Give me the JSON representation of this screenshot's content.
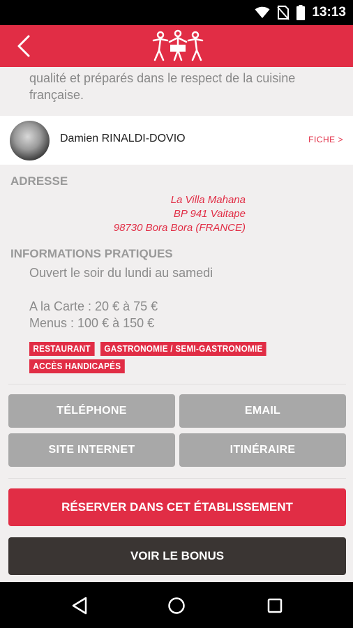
{
  "status_bar": {
    "time": "13:13",
    "icons": [
      "wifi-icon",
      "no-sim-icon",
      "battery-icon"
    ]
  },
  "app_bar": {
    "back_icon": "chevron-left-icon",
    "logo": "restaurant-figures-logo",
    "color": "#e12d45"
  },
  "description": {
    "line1": "qualité et préparés dans le respect de la cuisine",
    "line2": "française."
  },
  "chef": {
    "name": "Damien RINALDI-DOVIO",
    "link_label": "FICHE >"
  },
  "address": {
    "title": "ADRESSE",
    "line1": "La Villa Mahana",
    "line2": "BP 941 Vaitape",
    "line3": "98730 Bora Bora (FRANCE)"
  },
  "practical": {
    "title": "INFORMATIONS PRATIQUES",
    "hours": "Ouvert le soir du lundi au samedi",
    "carte": "A la Carte : 20 € à 75 €",
    "menus": "Menus : 100 € à 150 €"
  },
  "tags": [
    "RESTAURANT",
    "GASTRONOMIE / SEMI-GASTRONOMIE",
    "ACCÈS HANDICAPÉS"
  ],
  "actions": {
    "phone": "TÉLÉPHONE",
    "email": "EMAIL",
    "website": "SITE INTERNET",
    "itinerary": "ITINÉRAIRE",
    "reserve": "RÉSERVER DANS CET ÉTABLISSEMENT",
    "bonus": "VOIR LE BONUS"
  },
  "nav": {
    "back_icon": "nav-back-icon",
    "home_icon": "nav-home-icon",
    "recents_icon": "nav-recents-icon"
  },
  "colors": {
    "accent": "#e12d45",
    "button_grey": "#a8a8a8",
    "button_dark": "#3a3533",
    "background": "#f1efef"
  }
}
